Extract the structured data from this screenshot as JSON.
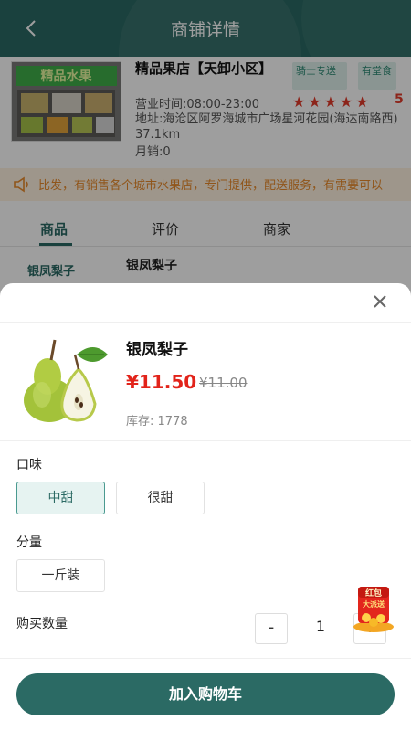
{
  "header": {
    "title": "商铺详情"
  },
  "store": {
    "name": "精品果店【天卸小区】",
    "photo_sign": "精品水果",
    "tags": [
      "骑士专送",
      "有堂食"
    ],
    "hours": "营业时间:08:00-23:00",
    "stars": "★★★★★",
    "rating": "5",
    "address": "地址:海沧区阿罗海城市广场星河花园(海达南路西) 37.1km",
    "sales": "月销:0"
  },
  "notice": {
    "text": "比发，有销售各个城市水果店，专门提供，配送服务，有需要可以"
  },
  "tabs": [
    {
      "label": "商品"
    },
    {
      "label": "评价"
    },
    {
      "label": "商家"
    }
  ],
  "category": {
    "label": "银凤梨子"
  },
  "bg_product": {
    "name": "银凤梨子"
  },
  "sheet": {
    "product_name": "银凤梨子",
    "price": "¥11.50",
    "original_price": "¥11.00",
    "stock": "库存: 1778",
    "flavor_label": "口味",
    "flavor_options": [
      "中甜",
      "很甜"
    ],
    "portion_label": "分量",
    "portion_options": [
      "一斤装"
    ],
    "qty_label": "购买数量",
    "qty_minus": "-",
    "qty_value": "1",
    "qty_plus": "+",
    "add_to_cart": "加入购物车"
  },
  "promo": {
    "line1": "红包",
    "line2": "大派送"
  },
  "colors": {
    "primary": "#2b6a64",
    "price": "#e2231a",
    "notice": "#e8892a",
    "star": "#e23b2b"
  },
  "icons": [
    "back-icon",
    "speaker-icon",
    "close-icon",
    "star-icon",
    "pear-image",
    "red-packet-icon"
  ]
}
